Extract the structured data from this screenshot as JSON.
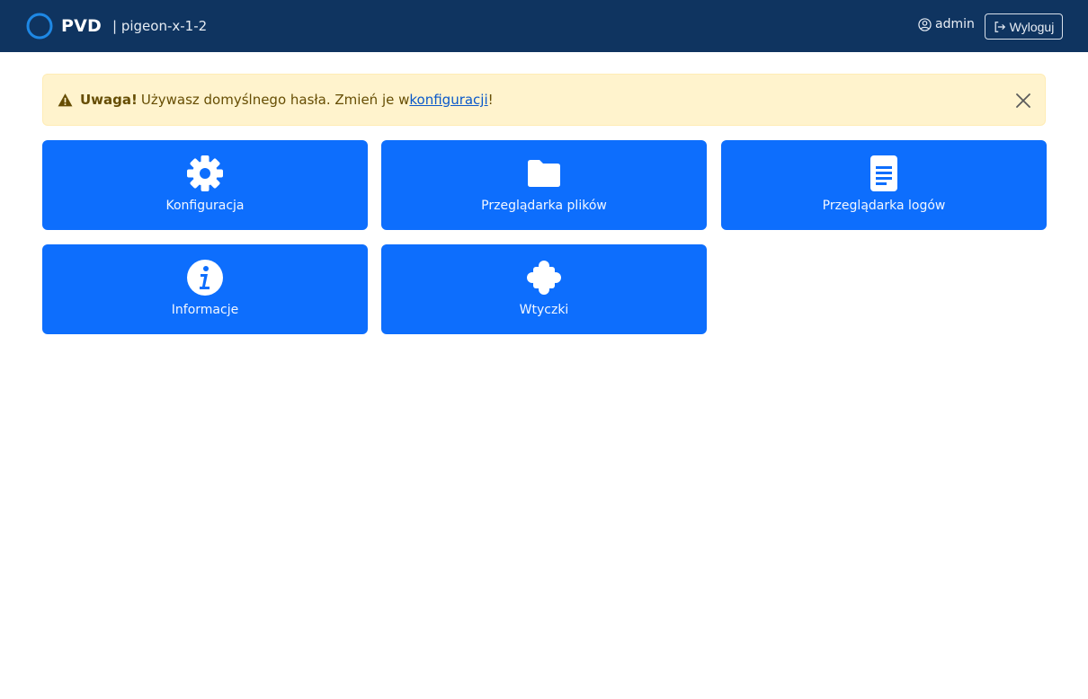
{
  "header": {
    "brand": "PVD",
    "hostname": "| pigeon-x-1-2",
    "user": "admin",
    "logout_label": "Wyloguj"
  },
  "alert": {
    "strong": "Uwaga!",
    "text": "Używasz domyślnego hasła. Zmień je w ",
    "link": "konfiguracji",
    "suffix": "!"
  },
  "tiles": [
    {
      "label": "Konfiguracja",
      "icon": "gear-icon"
    },
    {
      "label": "Przeglądarka plików",
      "icon": "folder-icon"
    },
    {
      "label": "Przeglądarka logów",
      "icon": "document-icon"
    },
    {
      "label": "Informacje",
      "icon": "info-icon"
    },
    {
      "label": "Wtyczki",
      "icon": "puzzle-icon"
    }
  ],
  "colors": {
    "navbar": "#0f3460",
    "tile": "#0d6efd",
    "alert_bg": "#fff3cd",
    "alert_text": "#664d03"
  }
}
